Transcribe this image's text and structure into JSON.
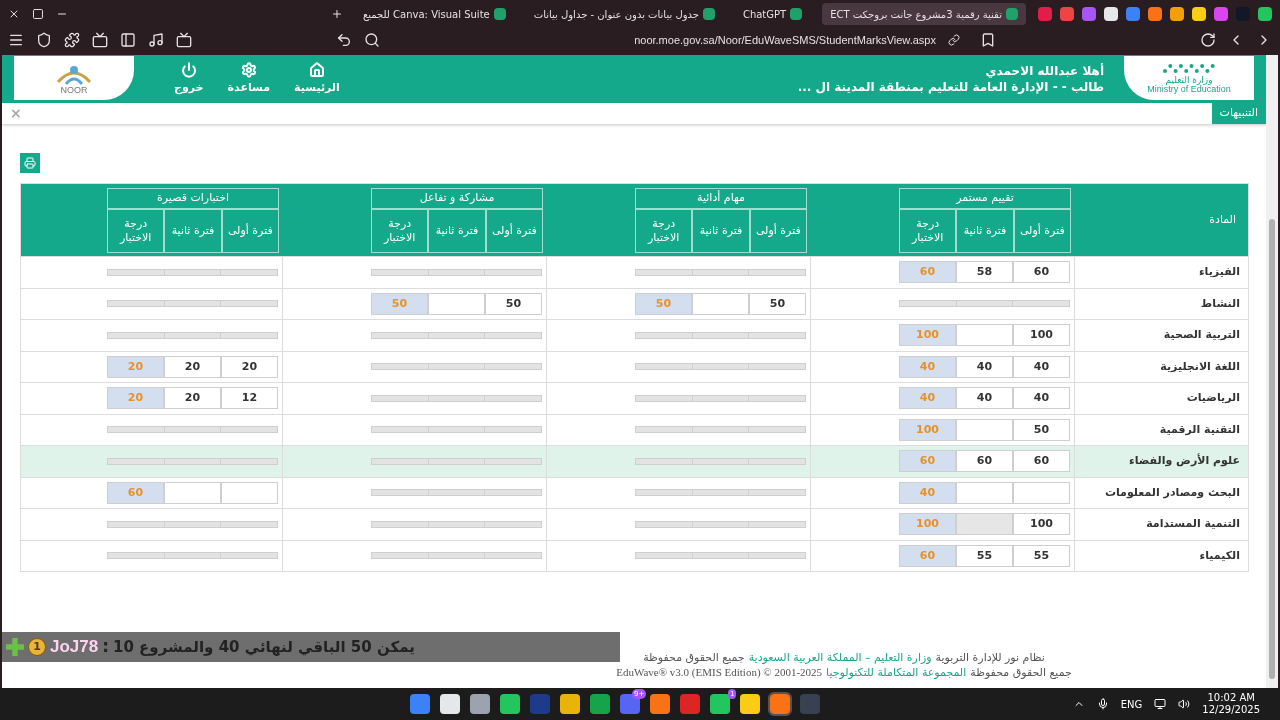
{
  "browser": {
    "tabs": [
      {
        "title": "تقنية رقمية 3مشروع جانت بروجكت ECT",
        "selected": true
      },
      {
        "title": "ChatGPT",
        "selected": false
      },
      {
        "title": "جدول بيانات بدون عنوان - جداول بيانات",
        "selected": false
      },
      {
        "title": "Canva: Visual Suite للجميع",
        "selected": false
      }
    ],
    "url": "noor.moe.gov.sa/Noor/EduWaveSMS/StudentMarksView.aspx"
  },
  "header": {
    "ministry_ar": "وزارة التعليم",
    "ministry_en": "Ministry of Education",
    "greeting": "أهلا  عبدالله الاحمدي",
    "role": "طالب - - الإدارة العامة للتعليم بمنطقة المدينة ال ...",
    "logo_text": "NOOR",
    "nav": [
      {
        "kind": "home",
        "label": "الرئيسية"
      },
      {
        "kind": "help",
        "label": "مساعدة"
      },
      {
        "kind": "logout",
        "label": "خروج"
      }
    ]
  },
  "alerts": {
    "label": "التنبيهات",
    "close": "×"
  },
  "table": {
    "subject_header": "المادة",
    "groups": [
      {
        "title": "تقييم مستمر",
        "columns": [
          "فترة أولى",
          "فترة ثانية",
          "درجة الاختبار"
        ]
      },
      {
        "title": "مهام أدائية",
        "columns": [
          "فترة أولى",
          "فترة ثانية",
          "درجة الاختبار"
        ]
      },
      {
        "title": "مشاركة و تفاعل",
        "columns": [
          "فترة أولى",
          "فترة ثانية",
          "درجة الاختبار"
        ]
      },
      {
        "title": "اختبارات قصيرة",
        "columns": [
          "فترة أولى",
          "فترة ثانية",
          "درجة الاختبار"
        ]
      }
    ],
    "rows": [
      {
        "subject": "الفيزياء",
        "highlighted": false,
        "marks": [
          {
            "kind": "scores",
            "first": "60",
            "second": "58",
            "exam": "60"
          },
          {
            "kind": "blank"
          },
          {
            "kind": "blank"
          },
          {
            "kind": "blank"
          }
        ]
      },
      {
        "subject": "النشاط",
        "highlighted": false,
        "marks": [
          {
            "kind": "blank"
          },
          {
            "kind": "scores",
            "first": "50",
            "exam": "50"
          },
          {
            "kind": "scores",
            "first": "50",
            "exam": "50"
          },
          {
            "kind": "blank"
          }
        ]
      },
      {
        "subject": "التربية الصحية",
        "highlighted": false,
        "marks": [
          {
            "kind": "scores",
            "first": "100",
            "exam": "100"
          },
          {
            "kind": "blank"
          },
          {
            "kind": "blank"
          },
          {
            "kind": "blank"
          }
        ]
      },
      {
        "subject": "اللغة الانجليزية",
        "highlighted": false,
        "marks": [
          {
            "kind": "scores",
            "first": "40",
            "second": "40",
            "exam": "40"
          },
          {
            "kind": "blank"
          },
          {
            "kind": "blank"
          },
          {
            "kind": "scores",
            "first": "20",
            "second": "20",
            "exam": "20"
          }
        ]
      },
      {
        "subject": "الرياضيات",
        "highlighted": false,
        "marks": [
          {
            "kind": "scores",
            "first": "40",
            "second": "40",
            "exam": "40"
          },
          {
            "kind": "blank"
          },
          {
            "kind": "blank"
          },
          {
            "kind": "scores",
            "first": "12",
            "second": "20",
            "exam": "20"
          }
        ]
      },
      {
        "subject": "التقنية الرقمية",
        "highlighted": false,
        "marks": [
          {
            "kind": "scores",
            "first": "50",
            "exam": "100"
          },
          {
            "kind": "blank"
          },
          {
            "kind": "blank"
          },
          {
            "kind": "blank"
          }
        ]
      },
      {
        "subject": "علوم الأرض والفضاء",
        "highlighted": true,
        "marks": [
          {
            "kind": "scores",
            "first": "60",
            "second": "60",
            "exam": "60"
          },
          {
            "kind": "blank"
          },
          {
            "kind": "blank"
          },
          {
            "kind": "blank"
          }
        ]
      },
      {
        "subject": "البحث ومصادر المعلومات",
        "highlighted": false,
        "marks": [
          {
            "kind": "scores",
            "exam": "40"
          },
          {
            "kind": "blank"
          },
          {
            "kind": "blank"
          },
          {
            "kind": "scores",
            "exam": "60"
          }
        ]
      },
      {
        "subject": "التنمية المستدامة",
        "highlighted": false,
        "marks": [
          {
            "kind": "scores",
            "first": "100",
            "second_disabled": true,
            "exam": "100"
          },
          {
            "kind": "blank"
          },
          {
            "kind": "blank"
          },
          {
            "kind": "blank"
          }
        ]
      },
      {
        "subject": "الكيمياء",
        "highlighted": false,
        "marks": [
          {
            "kind": "scores",
            "first": "55",
            "second": "55",
            "exam": "60"
          },
          {
            "kind": "blank"
          },
          {
            "kind": "blank"
          },
          {
            "kind": "blank"
          }
        ]
      }
    ]
  },
  "chat_overlay": {
    "badge": "1",
    "name": "JoJ78",
    "separator": ":",
    "message": "يمكن 50 الباقي لنهائي 40 والمشروع 10"
  },
  "footer": [
    [
      {
        "text": "نظام نور للإدارة التربوية",
        "kind": "plain"
      },
      {
        "text": "وزارة التعليم – المملكة العربية السعودية",
        "kind": "link"
      },
      {
        "text": "جميع الحقوق محفوظة",
        "kind": "plain"
      }
    ],
    [
      {
        "text": "جميع الحقوق محفوظة",
        "kind": "plain"
      },
      {
        "text": "المجموعة المتكاملة للتكنولوجيا",
        "kind": "link"
      },
      {
        "text": "EduWave® v3.0 (EMIS Edition) © 2001-2025",
        "kind": "plain"
      }
    ]
  ],
  "taskbar": {
    "apps": [
      {
        "kind": "obs"
      },
      {
        "kind": "brave",
        "selected": true
      },
      {
        "kind": "chrome"
      },
      {
        "kind": "whatsapp",
        "badge": "1"
      },
      {
        "kind": "news"
      },
      {
        "kind": "brave"
      },
      {
        "kind": "discord",
        "badge": "9+"
      },
      {
        "kind": "xbox"
      },
      {
        "kind": "folder"
      },
      {
        "kind": "steam"
      },
      {
        "kind": "edge"
      },
      {
        "kind": "files"
      },
      {
        "kind": "search"
      },
      {
        "kind": "start"
      }
    ],
    "language": "ENG",
    "time": "10:02 AM",
    "date": "12/29/2025"
  }
}
